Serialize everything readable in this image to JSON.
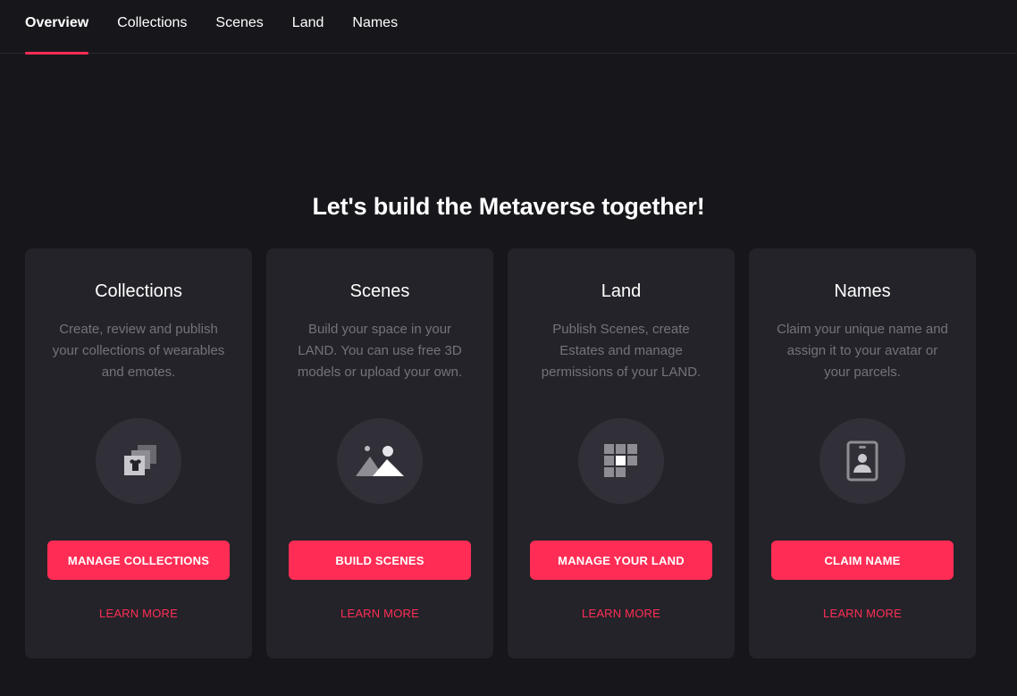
{
  "nav": {
    "tabs": [
      {
        "label": "Overview",
        "active": true
      },
      {
        "label": "Collections"
      },
      {
        "label": "Scenes"
      },
      {
        "label": "Land"
      },
      {
        "label": "Names"
      }
    ]
  },
  "headline": "Let's build the Metaverse together!",
  "cards": [
    {
      "title": "Collections",
      "description": "Create, review and publish your collections of wearables and emotes.",
      "icon": "collections-icon",
      "button": "MANAGE COLLECTIONS",
      "link": "LEARN MORE"
    },
    {
      "title": "Scenes",
      "description": "Build your space in your LAND. You can use free 3D models or upload your own.",
      "icon": "scenes-icon",
      "button": "BUILD SCENES",
      "link": "LEARN MORE"
    },
    {
      "title": "Land",
      "description": "Publish Scenes, create Estates and manage permissions of your LAND.",
      "icon": "land-icon",
      "button": "MANAGE YOUR LAND",
      "link": "LEARN MORE"
    },
    {
      "title": "Names",
      "description": "Claim your unique name and assign it to your avatar or your parcels.",
      "icon": "names-icon",
      "button": "CLAIM NAME",
      "link": "LEARN MORE"
    }
  ],
  "colors": {
    "background": "#17161b",
    "card": "#242329",
    "accent": "#ff2d55",
    "muted_text": "#74737a"
  }
}
